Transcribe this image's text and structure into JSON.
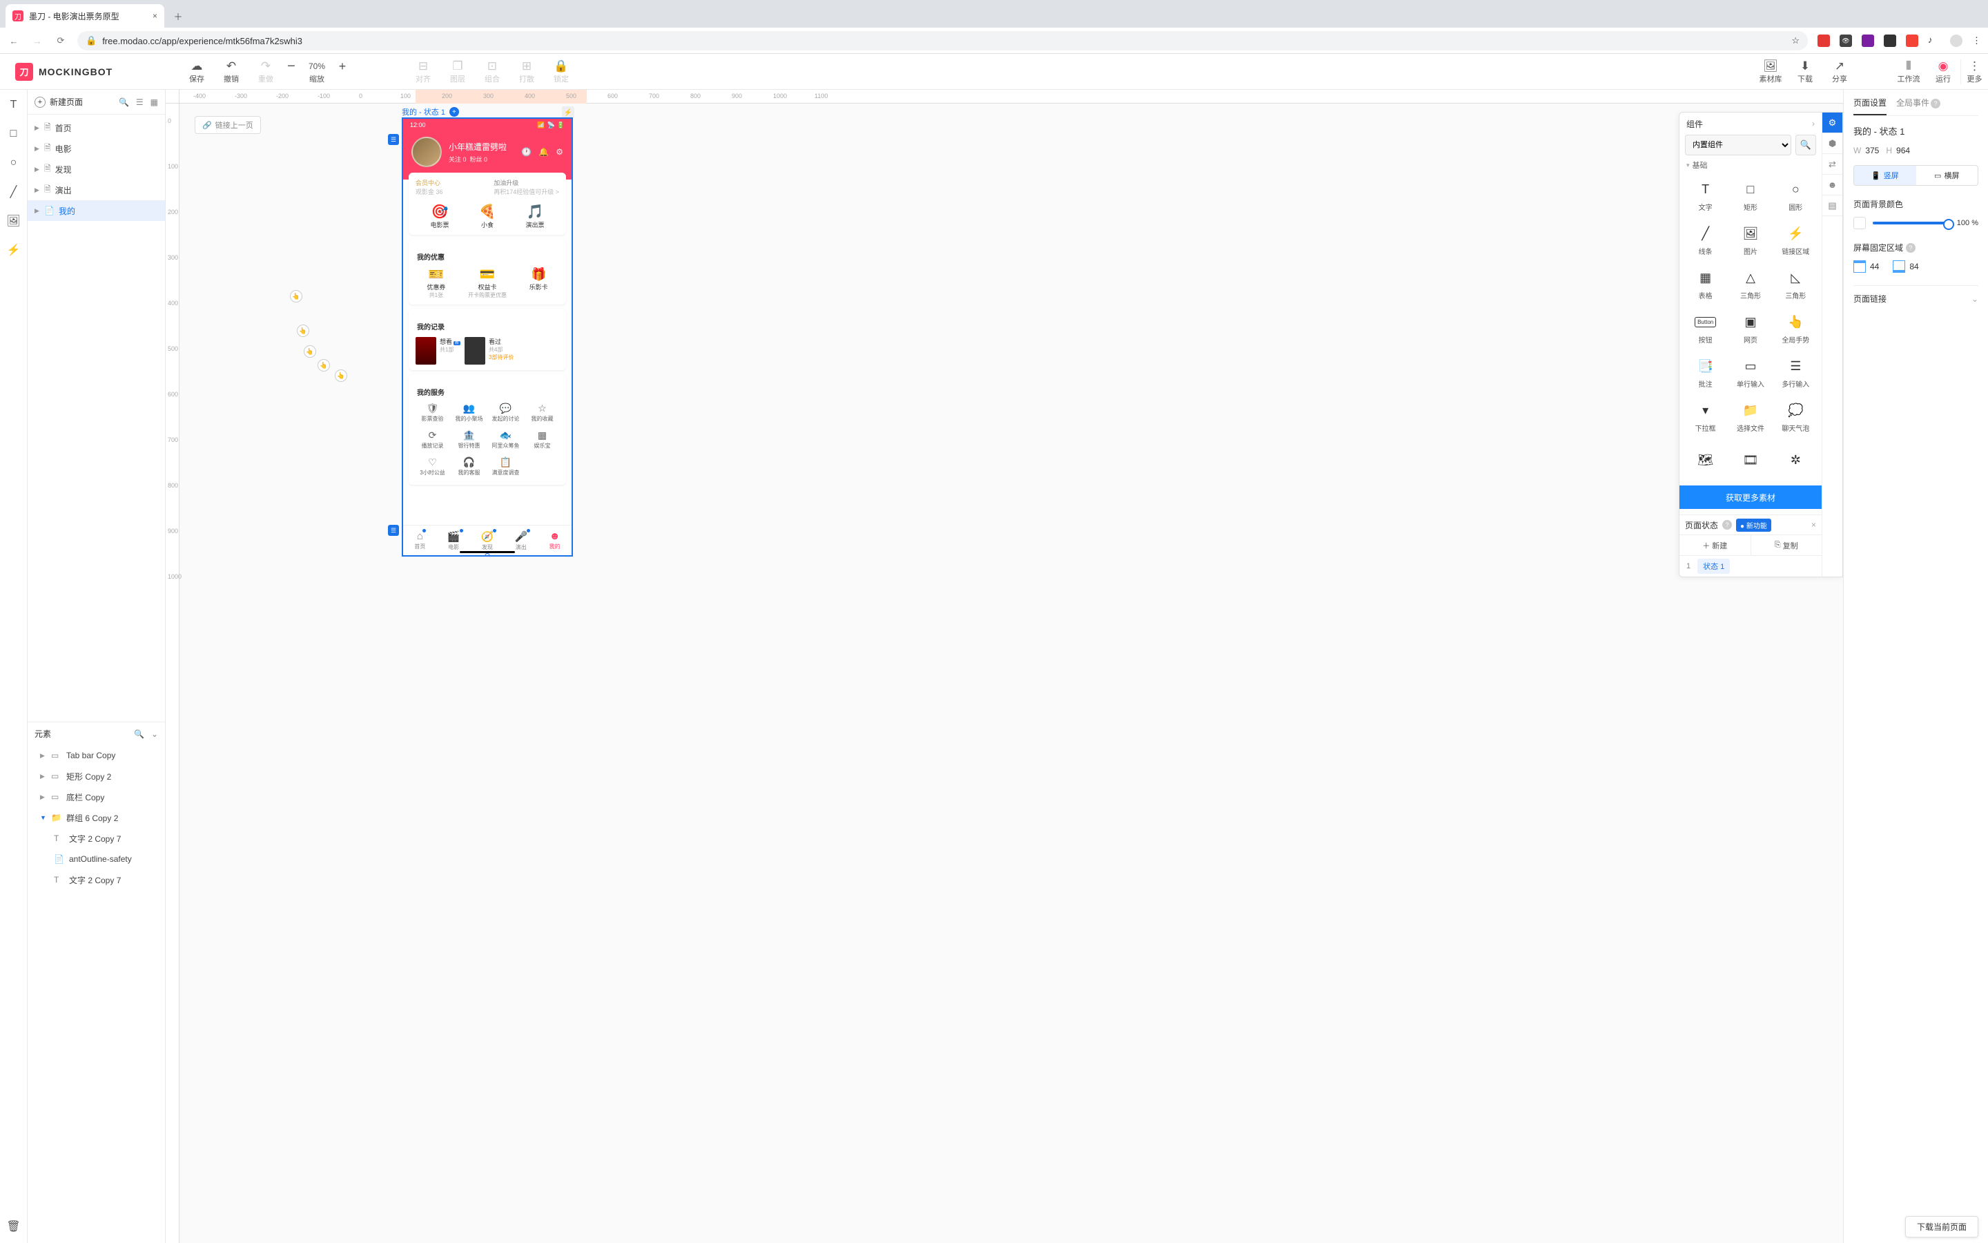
{
  "browser": {
    "tab_title": "墨刀 - 电影演出票务原型",
    "url": "free.modao.cc/app/experience/mtk56fma7k2swhi3"
  },
  "logo": "MOCKINGBOT",
  "toolbar": {
    "save": "保存",
    "undo": "撤销",
    "redo": "重做",
    "zoom_pct": "70%",
    "zoom_label": "缩放",
    "align": "对齐",
    "layer": "图层",
    "group": "组合",
    "ungroup": "打散",
    "lock": "锁定",
    "assets": "素材库",
    "download": "下载",
    "share": "分享",
    "workflow": "工作流",
    "run": "运行",
    "more": "更多"
  },
  "left": {
    "new_page": "新建页面",
    "pages": [
      "首页",
      "电影",
      "发现",
      "演出",
      "我的"
    ],
    "elements_header": "元素",
    "elements": [
      {
        "name": "Tab bar Copy",
        "icon": "▭"
      },
      {
        "name": "矩形 Copy 2",
        "icon": "▭"
      },
      {
        "name": "底栏 Copy",
        "icon": "▭"
      },
      {
        "name": "群组 6 Copy 2",
        "icon": "📁",
        "open": true
      },
      {
        "name": "文字 2 Copy 7",
        "icon": "T",
        "sub": true
      },
      {
        "name": "antOutline-safety",
        "icon": "📄",
        "sub": true
      },
      {
        "name": "文字 2 Copy 7",
        "icon": "T",
        "sub": true
      }
    ]
  },
  "canvas": {
    "link_prev": "链接上一页",
    "artboard_label": "我的 - 状态 1",
    "ruler_h": [
      "-400",
      "-300",
      "-200",
      "-100",
      "0",
      "100",
      "200",
      "300",
      "400",
      "500",
      "600",
      "700",
      "800",
      "900",
      "1000",
      "1100"
    ],
    "ruler_v": [
      "0",
      "100",
      "200",
      "300",
      "400",
      "500",
      "600",
      "700",
      "800",
      "900",
      "1000"
    ]
  },
  "phone": {
    "time": "12:00",
    "profile_name": "小年糕遭雷劈啦",
    "follow": "关注 0",
    "fans": "粉丝 0",
    "vip_title": "会员中心",
    "vip_sub": "观影金 36",
    "vip_upgrade": "加油升级",
    "vip_upgrade_sub": "再积174经验值可升级 >",
    "tickets": [
      {
        "icon": "🎯",
        "label": "电影票",
        "color": "c-pink"
      },
      {
        "icon": "🍕",
        "label": "小食",
        "color": "c-orange"
      },
      {
        "icon": "🎵",
        "label": "演出票",
        "color": "c-purple"
      }
    ],
    "sec_coupons": "我的优惠",
    "coupons": [
      {
        "icon": "🎫",
        "label": "优惠券",
        "sub": "共1张"
      },
      {
        "icon": "💳",
        "label": "权益卡",
        "sub": "开卡购票更优惠"
      },
      {
        "icon": "🎁",
        "label": "乐影卡",
        "sub": ""
      }
    ],
    "sec_records": "我的记录",
    "records": [
      {
        "title": "想看",
        "sub": "共1部",
        "badge": true
      },
      {
        "title": "看过",
        "sub": "共4部",
        "extra": "3部待评价"
      }
    ],
    "sec_services": "我的服务",
    "services": [
      {
        "icon": "🛡",
        "label": "影票查验"
      },
      {
        "icon": "👥",
        "label": "我的小聚场"
      },
      {
        "icon": "💬",
        "label": "发起的讨论"
      },
      {
        "icon": "☆",
        "label": "我的收藏"
      },
      {
        "icon": "⟳",
        "label": "播放记录"
      },
      {
        "icon": "🏦",
        "label": "银行特惠"
      },
      {
        "icon": "🐟",
        "label": "阿里众筹鱼"
      },
      {
        "icon": "▦",
        "label": "娱乐宝"
      },
      {
        "icon": "♡",
        "label": "3小时公益"
      },
      {
        "icon": "🎧",
        "label": "我的客服"
      },
      {
        "icon": "📋",
        "label": "满意度调查"
      }
    ],
    "tabs": [
      {
        "icon": "⌂",
        "label": "首页"
      },
      {
        "icon": "🎬",
        "label": "电影"
      },
      {
        "icon": "🧭",
        "label": "发现"
      },
      {
        "icon": "🎤",
        "label": "演出"
      },
      {
        "icon": "☻",
        "label": "我的",
        "active": true
      }
    ]
  },
  "components": {
    "header": "组件",
    "dropdown": "内置组件",
    "category": "基础",
    "items": [
      {
        "icon": "T",
        "name": "文字"
      },
      {
        "icon": "□",
        "name": "矩形"
      },
      {
        "icon": "○",
        "name": "圆形"
      },
      {
        "icon": "╱",
        "name": "线条"
      },
      {
        "icon": "🖼",
        "name": "图片"
      },
      {
        "icon": "⚡",
        "name": "链接区域"
      },
      {
        "icon": "▦",
        "name": "表格"
      },
      {
        "icon": "△",
        "name": "三角形"
      },
      {
        "icon": "◺",
        "name": "三角形"
      },
      {
        "icon": "Btn",
        "name": "按钮"
      },
      {
        "icon": "▣",
        "name": "网页"
      },
      {
        "icon": "👆",
        "name": "全局手势"
      },
      {
        "icon": "📑",
        "name": "批注"
      },
      {
        "icon": "▭",
        "name": "单行输入"
      },
      {
        "icon": "☰",
        "name": "多行输入"
      },
      {
        "icon": "▾",
        "name": "下拉框"
      },
      {
        "icon": "📁",
        "name": "选择文件"
      },
      {
        "icon": "💭",
        "name": "聊天气泡"
      },
      {
        "icon": "🗺",
        "name": ""
      },
      {
        "icon": "🎞",
        "name": ""
      },
      {
        "icon": "✲",
        "name": ""
      }
    ],
    "more": "获取更多素材",
    "rail": [
      "⚙",
      "⬢",
      "⇄",
      "☻",
      "▤"
    ]
  },
  "states": {
    "header": "页面状态",
    "new_feature": "新功能",
    "add": "新建",
    "copy": "复制",
    "rows": [
      {
        "num": "1",
        "name": "状态 1"
      }
    ]
  },
  "inspector": {
    "tab1": "页面设置",
    "tab2": "全局事件",
    "title": "我的 - 状态 1",
    "w": "375",
    "h": "964",
    "portrait": "竖屏",
    "landscape": "横屏",
    "bg_label": "页面背景颜色",
    "bg_pct": "100 %",
    "fixed_label": "屏幕固定区域",
    "fixed_top": "44",
    "fixed_bottom": "84",
    "page_link": "页面链接",
    "download": "下载当前页面"
  }
}
